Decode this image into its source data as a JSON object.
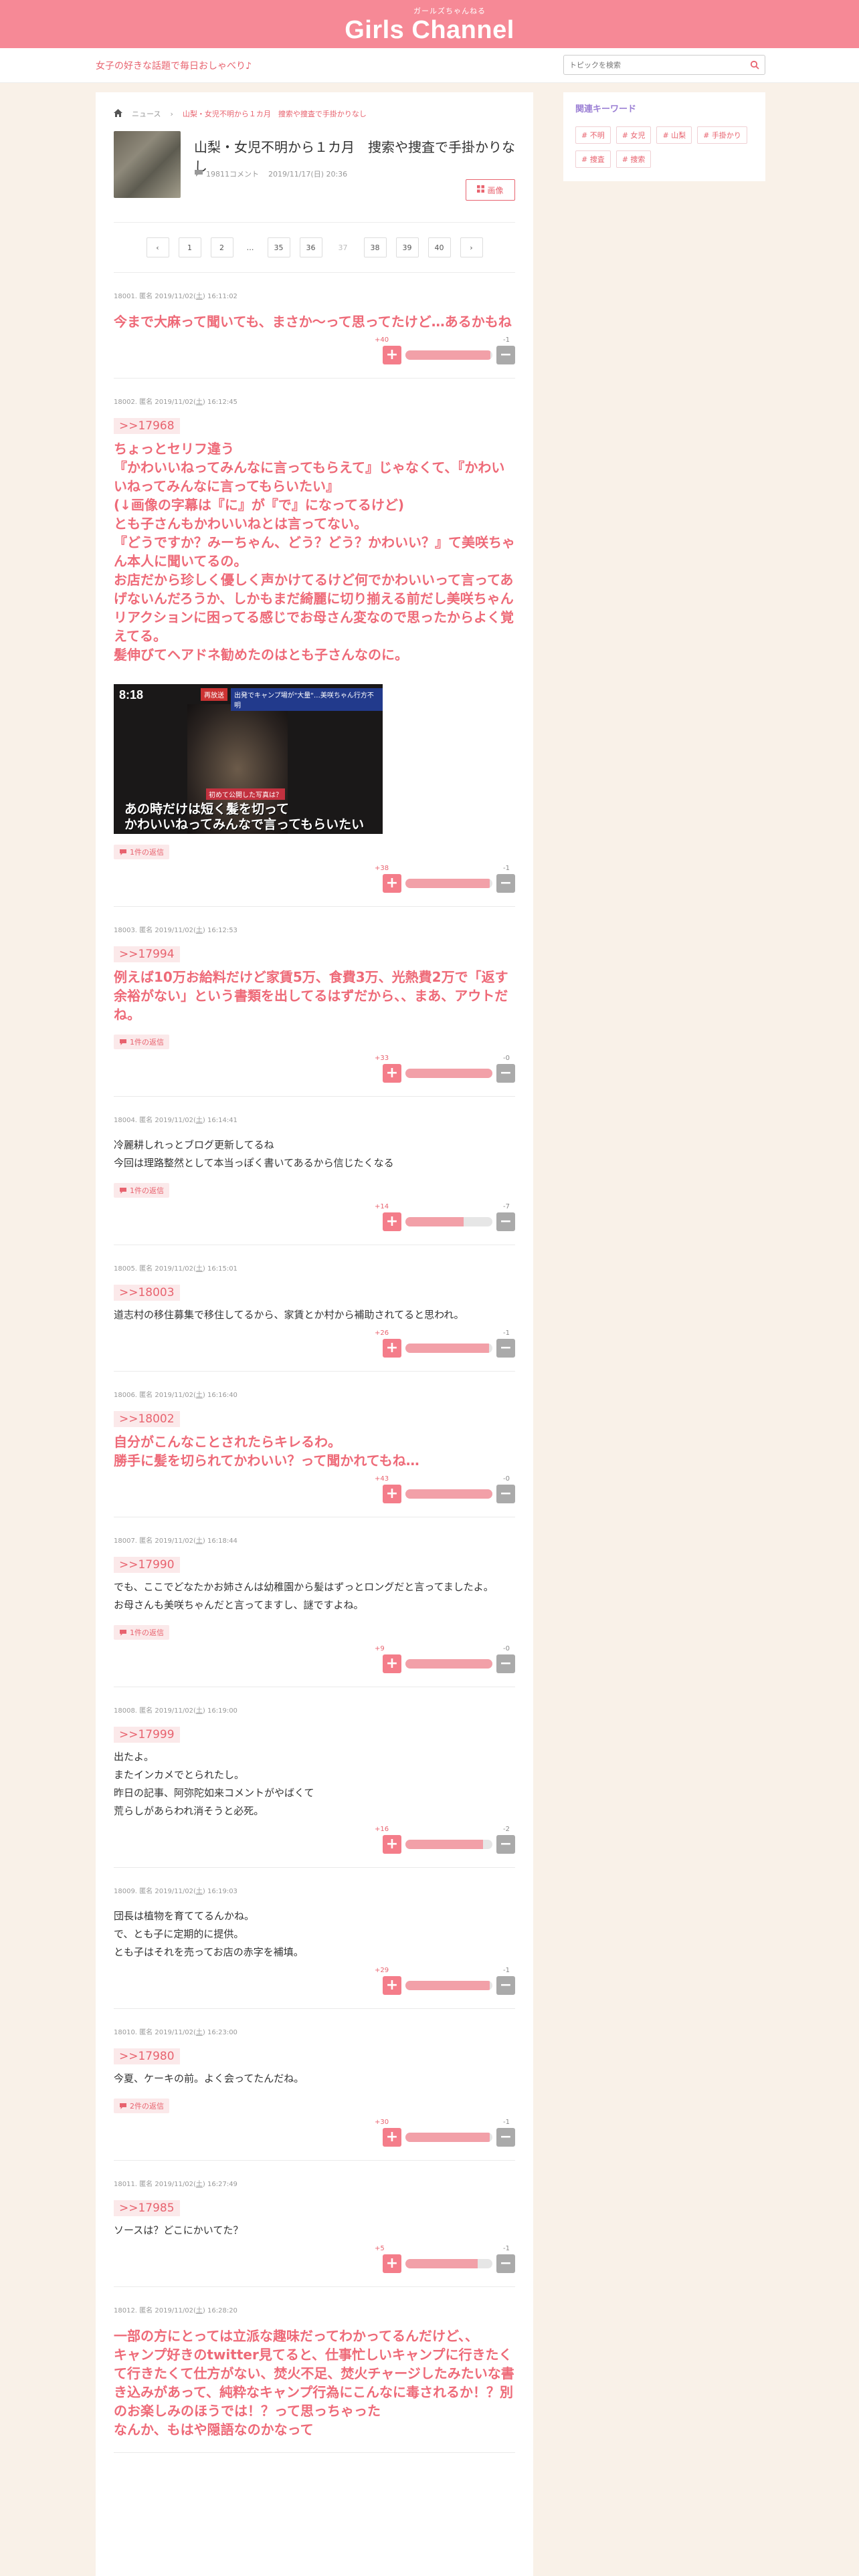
{
  "header": {
    "logo_sub": "ガールズちゃんねる",
    "logo_main": "Girls Channel"
  },
  "subheader": {
    "tagline": "女子の好きな話題で毎日おしゃべり♪",
    "search_placeholder": "トピックを検索"
  },
  "breadcrumb": {
    "home": "",
    "news": "ニュース",
    "current": "山梨・女児不明から１カ月　捜索や捜査で手掛かりなし"
  },
  "topic": {
    "title": "山梨・女児不明から１カ月　捜索や捜査で手掛かりなし",
    "comment_count": "19811コメント",
    "date": "2019/11/17(日) 20:36",
    "favorite_label": "画像"
  },
  "pager": {
    "prev": "‹",
    "pages": [
      "1",
      "2",
      "…",
      "35",
      "36",
      "37",
      "38",
      "39",
      "40"
    ],
    "current": "37",
    "next": "›"
  },
  "sidebar": {
    "title": "関連キーワード",
    "keywords": [
      "# 不明",
      "# 女児",
      "# 山梨",
      "# 手掛かり",
      "# 捜査",
      "# 捜索"
    ]
  },
  "comments": [
    {
      "num": "18001.",
      "name": "匿名",
      "date": "2019/11/02(",
      "dow": "土",
      "time": ") 16:11:02",
      "anchor": "",
      "style": "big",
      "body": "今まで大麻って聞いても、まさか〜って思ってたけど…あるかもね",
      "replies": "",
      "plus": "+40",
      "minus": "-1",
      "ratio": 0.98
    },
    {
      "num": "18002.",
      "name": "匿名",
      "date": "2019/11/02(",
      "dow": "土",
      "time": ") 16:12:45",
      "anchor": ">>17968",
      "style": "big",
      "body": "ちょっとセリフ違う\n『かわいいねってみんなに言ってもらえて』じゃなくて、『かわいいねってみんなに言ってもらいたい』\n(↓画像の字幕は『に』が『で』になってるけど)\nとも子さんもかわいいねとは言ってない。\n『どうですか？みーちゃん、どう？どう？かわいい？』て美咲ちゃん本人に聞いてるの。\nお店だから珍しく優しく声かけてるけど何でかわいいって言ってあげないんだろうか、しかもまだ綺麗に切り揃える前だし美咲ちゃんリアクションに困ってる感じでお母さん変なので思ったからよく覚えてる。\n髪伸びてヘアドネ勧めたのはとも子さんなのに。",
      "replies": "1件の返信",
      "plus": "+38",
      "minus": "-1",
      "ratio": 0.97,
      "image": {
        "time": "8:18",
        "head1": "再放送",
        "head2": "出発でキャンプ場が\"大量\"…美咲ちゃん行方不明",
        "label": "初めて公開した写真は？",
        "caption": "あの時だけは短く髪を切って\nかわいいねってみんなで言ってもらいたい"
      }
    },
    {
      "num": "18003.",
      "name": "匿名",
      "date": "2019/11/02(",
      "dow": "土",
      "time": ") 16:12:53",
      "anchor": ">>17994",
      "style": "big",
      "body": "例えば10万お給料だけど家賃5万、食費3万、光熱費2万で「返す余裕がない」という書類を出してるはずだから、、まあ、アウトだね。",
      "replies": "1件の返信",
      "plus": "+33",
      "minus": "-0",
      "ratio": 1.0
    },
    {
      "num": "18004.",
      "name": "匿名",
      "date": "2019/11/02(",
      "dow": "土",
      "time": ") 16:14:41",
      "anchor": "",
      "style": "mid",
      "body": "冷麗耕しれっとブログ更新してるね\n今回は理路整然として本当っぽく書いてあるから信じたくなる",
      "replies": "1件の返信",
      "plus": "+14",
      "minus": "-7",
      "ratio": 0.67
    },
    {
      "num": "18005.",
      "name": "匿名",
      "date": "2019/11/02(",
      "dow": "土",
      "time": ") 16:15:01",
      "anchor": ">>18003",
      "style": "mid",
      "body": "道志村の移住募集で移住してるから、家賃とか村から補助されてると思われ。",
      "replies": "",
      "plus": "+26",
      "minus": "-1",
      "ratio": 0.96
    },
    {
      "num": "18006.",
      "name": "匿名",
      "date": "2019/11/02(",
      "dow": "土",
      "time": ") 16:16:40",
      "anchor": ">>18002",
      "style": "big",
      "body": "自分がこんなことされたらキレるわ。\n勝手に髪を切られてかわいい？って聞かれてもね…",
      "replies": "",
      "plus": "+43",
      "minus": "-0",
      "ratio": 1.0
    },
    {
      "num": "18007.",
      "name": "匿名",
      "date": "2019/11/02(",
      "dow": "土",
      "time": ") 16:18:44",
      "anchor": ">>17990",
      "style": "mid",
      "body": "でも、ここでどなたかお姉さんは幼稚園から髪はずっとロングだと言ってましたよ。\nお母さんも美咲ちゃんだと言ってますし、謎ですよね。",
      "replies": "1件の返信",
      "plus": "+9",
      "minus": "-0",
      "ratio": 1.0
    },
    {
      "num": "18008.",
      "name": "匿名",
      "date": "2019/11/02(",
      "dow": "土",
      "time": ") 16:19:00",
      "anchor": ">>17999",
      "style": "mid",
      "body": "出たよ。\nまたインカメでとられたし。\n昨日の記事、阿弥陀如来コメントがやばくて\n荒らしがあらわれ消そうと必死。",
      "replies": "",
      "plus": "+16",
      "minus": "-2",
      "ratio": 0.89
    },
    {
      "num": "18009.",
      "name": "匿名",
      "date": "2019/11/02(",
      "dow": "土",
      "time": ") 16:19:03",
      "anchor": "",
      "style": "mid",
      "body": "団長は植物を育ててるんかね。\nで、とも子に定期的に提供。\nとも子はそれを売ってお店の赤字を補填。",
      "replies": "",
      "plus": "+29",
      "minus": "-1",
      "ratio": 0.97
    },
    {
      "num": "18010.",
      "name": "匿名",
      "date": "2019/11/02(",
      "dow": "土",
      "time": ") 16:23:00",
      "anchor": ">>17980",
      "style": "mid",
      "body": "今夏、ケーキの前。よく会ってたんだね。",
      "replies": "2件の返信",
      "plus": "+30",
      "minus": "-1",
      "ratio": 0.97
    },
    {
      "num": "18011.",
      "name": "匿名",
      "date": "2019/11/02(",
      "dow": "土",
      "time": ") 16:27:49",
      "anchor": ">>17985",
      "style": "mid",
      "body": "ソースは？どこにかいてた？",
      "replies": "",
      "plus": "+5",
      "minus": "-1",
      "ratio": 0.83
    },
    {
      "num": "18012.",
      "name": "匿名",
      "date": "2019/11/02(",
      "dow": "土",
      "time": ") 16:28:20",
      "anchor": "",
      "style": "big",
      "body": "一部の方にとっては立派な趣味だってわかってるんだけど、、\nキャンプ好きのtwitter見てると、仕事忙しいキャンプに行きたくて行きたくて仕方がない、焚火不足、焚火チャージしたみたいな書き込みがあって、純粋なキャンプ行為にこんなに毒されるか！？別のお楽しみのほうでは！？って思っちゃった\nなんか、もはや隠語なのかなって",
      "replies": "",
      "plus": "",
      "minus": "",
      "ratio": 0
    }
  ],
  "colors": {
    "brand": "#f68996",
    "accent": "#e8636f",
    "background": "#f9f1e8",
    "minus": "#aaaaaa"
  }
}
